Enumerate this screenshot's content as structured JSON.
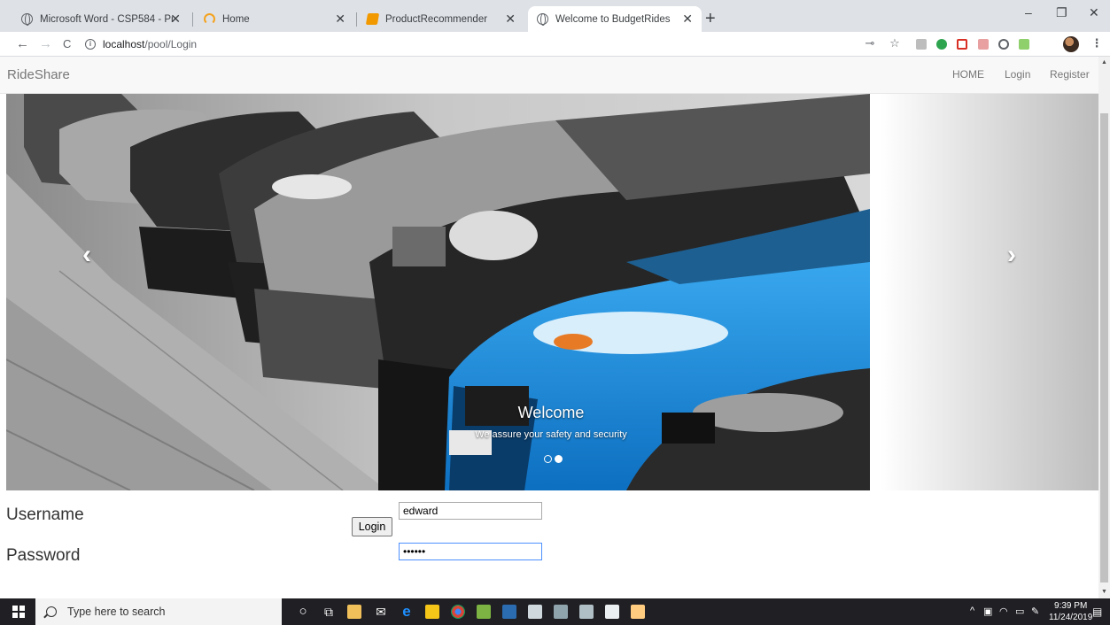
{
  "browser": {
    "tabs": [
      {
        "title": "Microsoft Word - CSP584 - Proje",
        "favicon": "globe-icon",
        "close": "✕"
      },
      {
        "title": "Home",
        "favicon": "ring-icon",
        "close": "✕"
      },
      {
        "title": "ProductRecommender",
        "favicon": "book-icon",
        "close": "✕"
      },
      {
        "title": "Welcome to BudgetRides",
        "favicon": "globe-icon",
        "close": "✕"
      }
    ],
    "new_tab": "+",
    "window_controls": {
      "minimize": "–",
      "maximize": "❐",
      "close": "✕"
    },
    "nav": {
      "back": "←",
      "forward": "→",
      "reload": "C"
    },
    "url": {
      "host": "localhost",
      "path": "/pool/Login",
      "info": "i"
    }
  },
  "page": {
    "brand": "RideShare",
    "nav_links": [
      "HOME",
      "Login",
      "Register"
    ],
    "carousel": {
      "prev": "‹",
      "next": "›",
      "caption_title": "Welcome",
      "caption_text": "We assure your safety and security",
      "indicator_count": 2,
      "active_indicator": 1
    },
    "form": {
      "username_label": "Username",
      "username_value": "edward",
      "password_label": "Password",
      "password_value": "••••••",
      "login_button": "Login"
    }
  },
  "taskbar": {
    "search_placeholder": "Type here to search",
    "time": "9:39 PM",
    "date": "11/24/2019",
    "tray_chevron": "^"
  },
  "colors": {
    "accent_blue": "#1a8fe0",
    "navbar_bg": "#f8f8f8",
    "taskbar_bg": "#1f1f24"
  }
}
